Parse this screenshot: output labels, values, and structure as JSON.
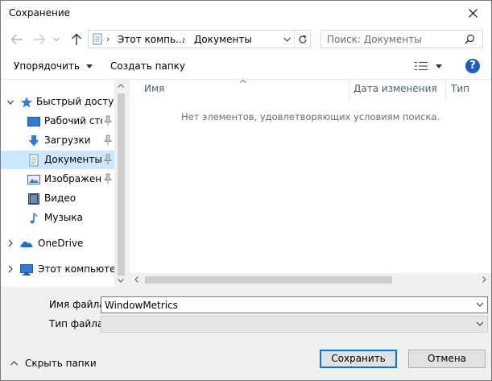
{
  "window": {
    "title": "Сохранение"
  },
  "address": {
    "crumbs": [
      "Этот компь...",
      "Документы"
    ]
  },
  "search": {
    "placeholder": "Поиск: Документы"
  },
  "toolbar": {
    "organize_label": "Упорядочить",
    "new_folder_label": "Создать папку"
  },
  "navigation": {
    "quick_access": "Быстрый доступ",
    "items": [
      {
        "label": "Рабочий сто",
        "icon": "desktop-icon",
        "pinned": true
      },
      {
        "label": "Загрузки",
        "icon": "downloads-icon",
        "pinned": true
      },
      {
        "label": "Документы",
        "icon": "documents-icon",
        "pinned": true,
        "selected": true
      },
      {
        "label": "Изображени",
        "icon": "pictures-icon",
        "pinned": true
      },
      {
        "label": "Видео",
        "icon": "video-icon",
        "pinned": false
      },
      {
        "label": "Музыка",
        "icon": "music-icon",
        "pinned": false
      }
    ],
    "onedrive": "OneDrive",
    "this_pc": "Этот компьютер"
  },
  "columns": {
    "name": "Имя",
    "date": "Дата изменения",
    "type": "Тип"
  },
  "file_list": {
    "empty_message": "Нет элементов, удовлетворяющих условиям поиска."
  },
  "form": {
    "filename_label": "Имя файла:",
    "filename_value": "WindowMetrics",
    "filetype_label": "Тип файла:",
    "filetype_value": ""
  },
  "actions": {
    "hide_folders": "Скрыть папки",
    "save": "Сохранить",
    "cancel": "Отмена"
  },
  "colors": {
    "accent": "#0078d7",
    "selected_bg": "#cce8ff",
    "link_blue": "#1e5dbf"
  }
}
